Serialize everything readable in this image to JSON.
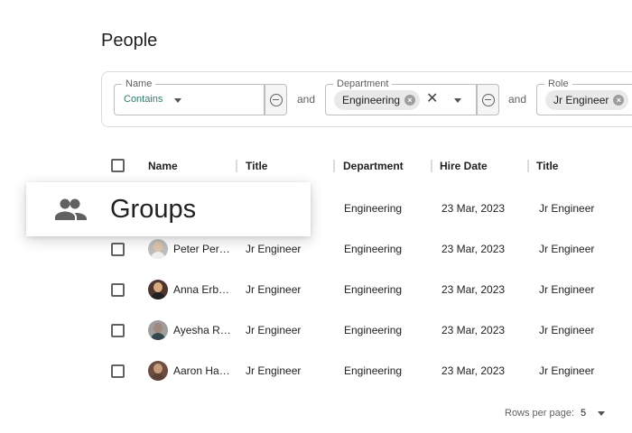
{
  "page": {
    "title": "People"
  },
  "filters": {
    "name": {
      "legend": "Name",
      "operator": "Contains"
    },
    "and1": "and",
    "department": {
      "legend": "Department",
      "chip": "Engineering"
    },
    "and2": "and",
    "role": {
      "legend": "Role",
      "chip": "Jr Engineer"
    }
  },
  "table": {
    "columns": [
      "Name",
      "Title",
      "Department",
      "Hire Date",
      "Title"
    ],
    "rows": [
      {
        "name": "",
        "title": "",
        "department": "Engineering",
        "hire_date": "23 Mar, 2023",
        "title2": "Jr Engineer"
      },
      {
        "name": "Peter Per…",
        "title": "Jr Engineer",
        "department": "Engineering",
        "hire_date": "23 Mar, 2023",
        "title2": "Jr Engineer"
      },
      {
        "name": "Anna Erb…",
        "title": "Jr Engineer",
        "department": "Engineering",
        "hire_date": "23 Mar, 2023",
        "title2": "Jr Engineer"
      },
      {
        "name": "Ayesha R…",
        "title": "Jr Engineer",
        "department": "Engineering",
        "hire_date": "23 Mar, 2023",
        "title2": "Jr Engineer"
      },
      {
        "name": "Aaron Ha…",
        "title": "Jr Engineer",
        "department": "Engineering",
        "hire_date": "23 Mar, 2023",
        "title2": "Jr Engineer"
      }
    ]
  },
  "overlay": {
    "label": "Groups",
    "icon": "groups-icon"
  },
  "footer": {
    "rows_per_page_label": "Rows per page:",
    "rows_per_page_value": "5"
  }
}
